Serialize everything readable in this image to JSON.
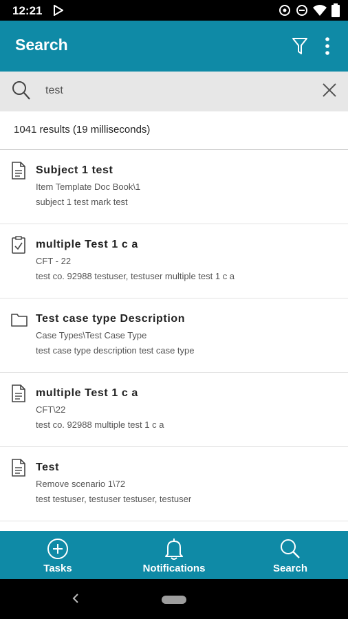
{
  "status_bar": {
    "time": "12:21"
  },
  "app_bar": {
    "title": "Search"
  },
  "search": {
    "query": "test"
  },
  "summary": "1041 results (19 milliseconds)",
  "results": [
    {
      "icon": "document-icon",
      "title": "Subject 1 test",
      "subtitle": "Item Template Doc Book\\1",
      "snippet": "subject 1 test mark test"
    },
    {
      "icon": "task-checklist-icon",
      "title": "multiple Test 1 c a",
      "subtitle": "CFT - 22",
      "snippet": "test co. 92988 testuser, testuser multiple test 1 c a"
    },
    {
      "icon": "folder-icon",
      "title": "Test case type Description",
      "subtitle": "Case Types\\Test Case Type",
      "snippet": "test case type description test case type"
    },
    {
      "icon": "document-icon",
      "title": "multiple Test 1 c a",
      "subtitle": "CFT\\22",
      "snippet": "test co. 92988 multiple test 1 c a"
    },
    {
      "icon": "document-icon",
      "title": "Test",
      "subtitle": "Remove scenario 1\\72",
      "snippet": "test testuser, testuser testuser, testuser"
    }
  ],
  "bottom_nav": [
    {
      "label": "Tasks",
      "icon": "add-circle-icon"
    },
    {
      "label": "Notifications",
      "icon": "bell-icon"
    },
    {
      "label": "Search",
      "icon": "search-icon"
    }
  ],
  "colors": {
    "primary": "#0f8aa6",
    "search_bg": "#e7e7e7"
  }
}
